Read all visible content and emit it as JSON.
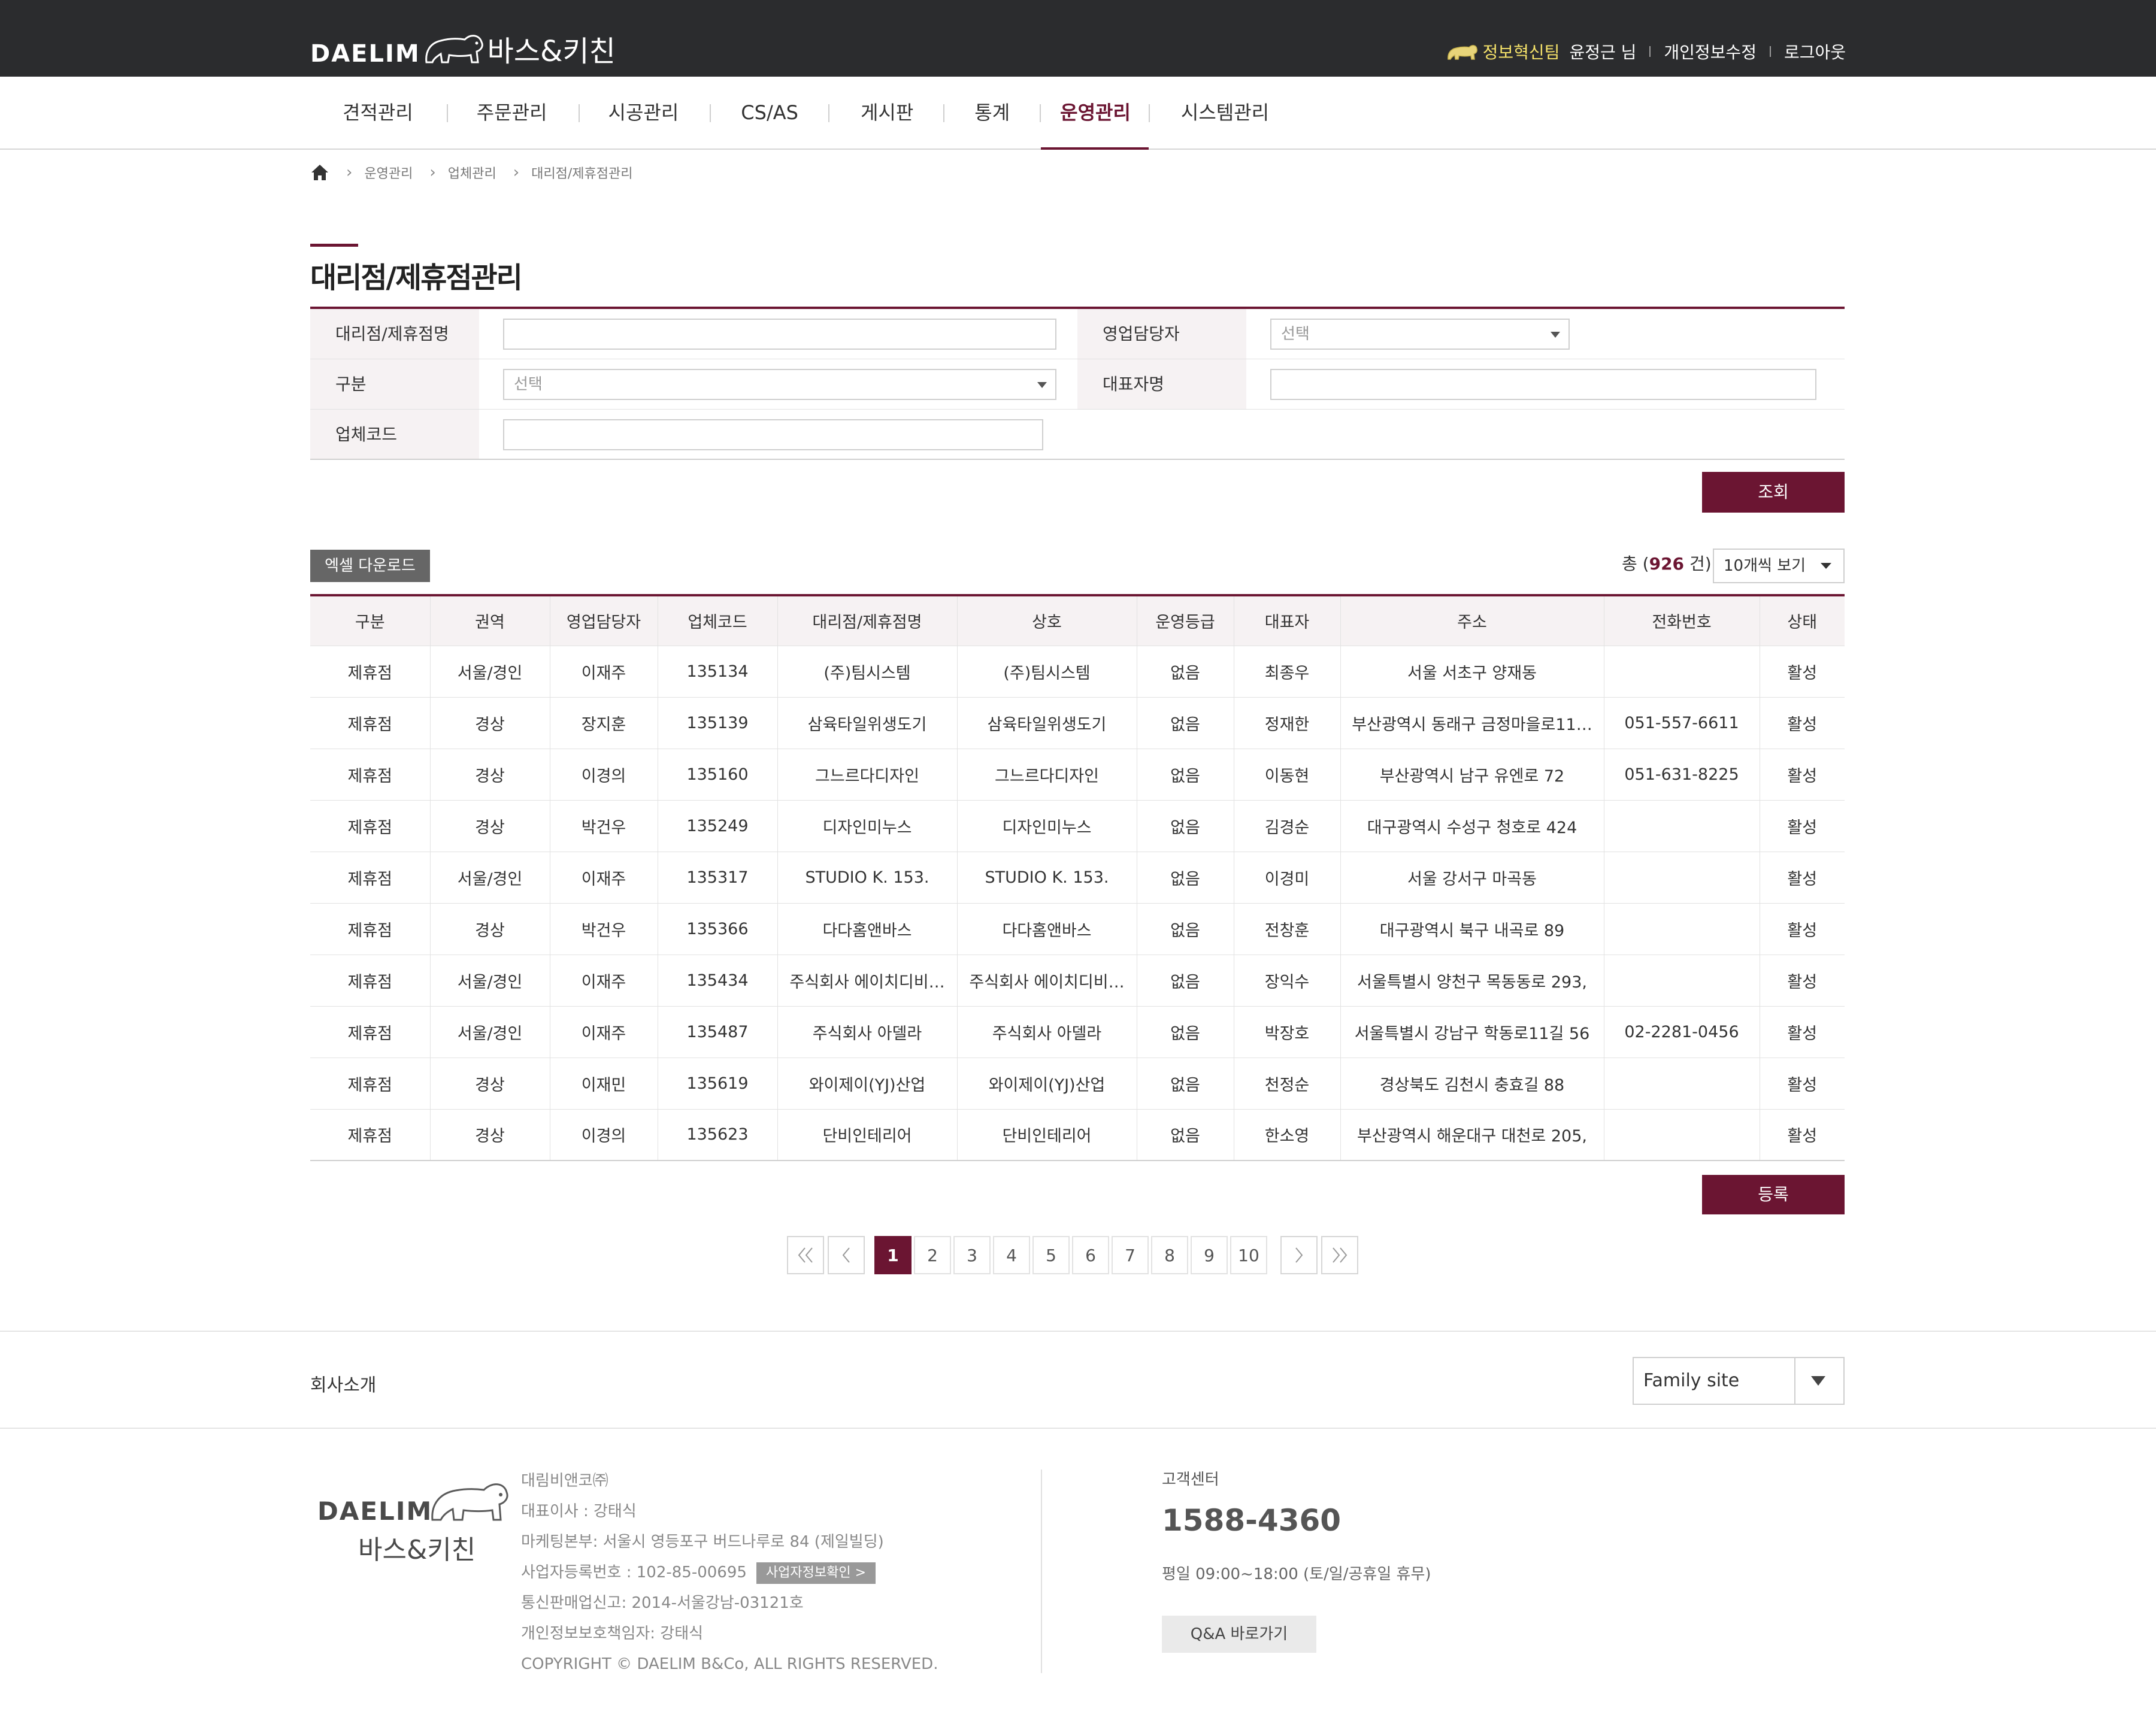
{
  "header": {
    "logo_daelim": "DAELIM",
    "logo_bath": "바스&키친",
    "team": "정보혁신팀",
    "user": "윤정근 님",
    "edit_info": "개인정보수정",
    "logout": "로그아웃"
  },
  "nav": {
    "items": [
      {
        "label": "견적관리"
      },
      {
        "label": "주문관리"
      },
      {
        "label": "시공관리"
      },
      {
        "label": "CS/AS"
      },
      {
        "label": "게시판"
      },
      {
        "label": "통계"
      },
      {
        "label": "운영관리",
        "active": true
      },
      {
        "label": "시스템관리"
      }
    ]
  },
  "breadcrumb": [
    "운영관리",
    "업체관리",
    "대리점/제휴점관리"
  ],
  "page_title": "대리점/제휴점관리",
  "search": {
    "agency_name_label": "대리점/제휴점명",
    "agency_name_value": "",
    "sales_manager_label": "영업담당자",
    "sales_manager_value": "선택",
    "type_label": "구분",
    "type_value": "선택",
    "ceo_label": "대표자명",
    "ceo_value": "",
    "code_label": "업체코드",
    "code_value": "",
    "search_button": "조회"
  },
  "list": {
    "excel_button": "엑셀 다운로드",
    "total_prefix": "총 (",
    "total_count": "926",
    "total_suffix": " 건)",
    "view_option": "10개씩 보기",
    "register_button": "등록"
  },
  "table": {
    "columns": [
      "구분",
      "권역",
      "영업담당자",
      "업체코드",
      "대리점/제휴점명",
      "상호",
      "운영등급",
      "대표자",
      "주소",
      "전화번호",
      "상태"
    ],
    "rows": [
      [
        "제휴점",
        "서울/경인",
        "이재주",
        "135134",
        "(주)팀시스템",
        "(주)팀시스템",
        "없음",
        "최종우",
        "서울 서초구 양재동",
        "",
        "활성"
      ],
      [
        "제휴점",
        "경상",
        "장지훈",
        "135139",
        "삼육타일위생도기",
        "삼육타일위생도기",
        "없음",
        "정재한",
        "부산광역시 동래구 금정마을로11…",
        "051-557-6611",
        "활성"
      ],
      [
        "제휴점",
        "경상",
        "이경의",
        "135160",
        "그느르다디자인",
        "그느르다디자인",
        "없음",
        "이동현",
        "부산광역시 남구 유엔로 72",
        "051-631-8225",
        "활성"
      ],
      [
        "제휴점",
        "경상",
        "박건우",
        "135249",
        "디자인미누스",
        "디자인미누스",
        "없음",
        "김경순",
        "대구광역시 수성구 청호로 424",
        "",
        "활성"
      ],
      [
        "제휴점",
        "서울/경인",
        "이재주",
        "135317",
        "STUDIO K. 153.",
        "STUDIO K. 153.",
        "없음",
        "이경미",
        "서울 강서구 마곡동",
        "",
        "활성"
      ],
      [
        "제휴점",
        "경상",
        "박건우",
        "135366",
        "다다홈앤바스",
        "다다홈앤바스",
        "없음",
        "전창훈",
        "대구광역시 북구 내곡로 89",
        "",
        "활성"
      ],
      [
        "제휴점",
        "서울/경인",
        "이재주",
        "135434",
        "주식회사 에이치디비…",
        "주식회사 에이치디비…",
        "없음",
        "장익수",
        "서울특별시 양천구 목동동로 293,",
        "",
        "활성"
      ],
      [
        "제휴점",
        "서울/경인",
        "이재주",
        "135487",
        "주식회사 아델라",
        "주식회사 아델라",
        "없음",
        "박장호",
        "서울특별시 강남구 학동로11길 56",
        "02-2281-0456",
        "활성"
      ],
      [
        "제휴점",
        "경상",
        "이재민",
        "135619",
        "와이제이(YJ)산업",
        "와이제이(YJ)산업",
        "없음",
        "천정순",
        "경상북도 김천시 충효길 88",
        "",
        "활성"
      ],
      [
        "제휴점",
        "경상",
        "이경의",
        "135623",
        "단비인테리어",
        "단비인테리어",
        "없음",
        "한소영",
        "부산광역시 해운대구 대천로 205,",
        "",
        "활성"
      ]
    ]
  },
  "pagination": {
    "first": "«",
    "prev": "‹",
    "pages": [
      "1",
      "2",
      "3",
      "4",
      "5",
      "6",
      "7",
      "8",
      "9",
      "10"
    ],
    "current": "1",
    "next": "›",
    "last": "»"
  },
  "footer": {
    "company_intro": "회사소개",
    "family_site": "Family site",
    "logo_daelim": "DAELIM",
    "logo_bath": "바스&키친",
    "company_name": "대림비앤코㈜",
    "ceo": "대표이사 : 강태식",
    "address": "마케팅본부: 서울시 영등포구 버드나루로 84 (제일빌딩)",
    "biz_number": "사업자등록번호 : 102-85-00695",
    "biz_check_button": "사업자정보확인 >",
    "mail_order": "통신판매업신고: 2014-서울강남-03121호",
    "privacy_officer": "개인정보보호책임자: 강태식",
    "copyright": "COPYRIGHT © DAELIM B&Co, ALL RIGHTS RESERVED.",
    "cs_title": "고객센터",
    "cs_phone": "1588-4360",
    "cs_hours": "평일 09:00~18:00 (토/일/공휴일 휴무)",
    "qa_button": "Q&A 바로가기"
  },
  "colors": {
    "accent": "#6b1532",
    "topbar": "#2b2c2e",
    "team_highlight": "#f6e36a"
  }
}
